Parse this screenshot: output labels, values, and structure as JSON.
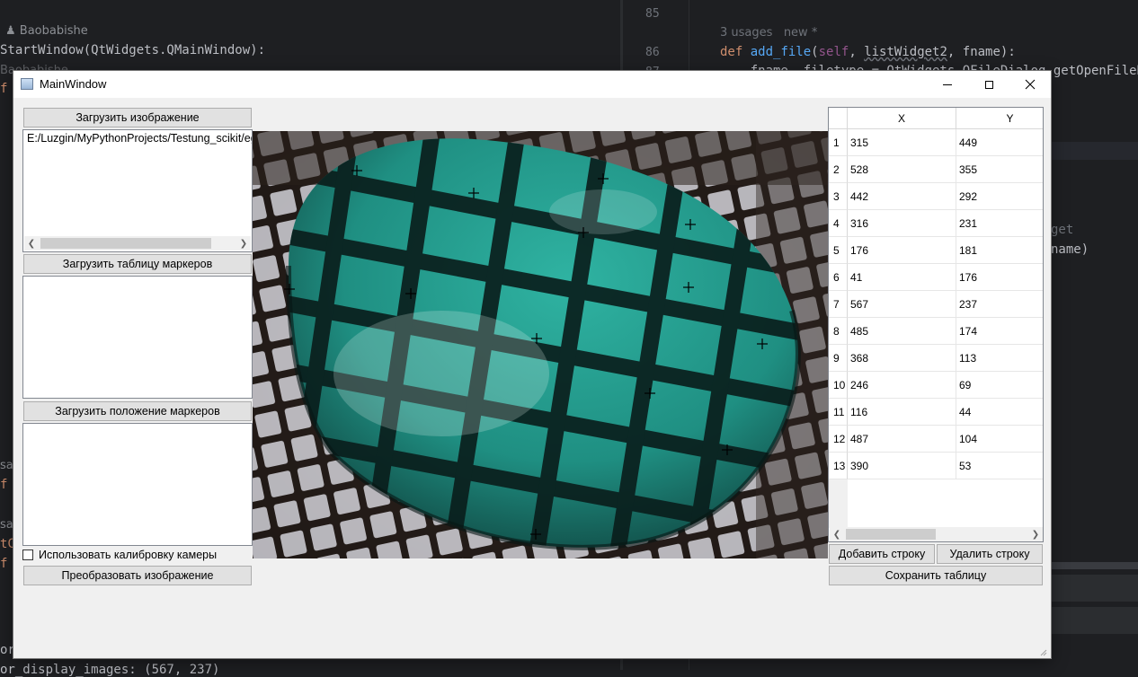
{
  "ide": {
    "author": "Baobabishe",
    "class_line": "StartWindow(QtWidgets.QMainWindow):",
    "ghost_author": "Baobabishe",
    "line_85": "85",
    "line_86": "86",
    "line_87": "87",
    "usages": "3 usages",
    "new_marker": "new *",
    "def_kw": "def",
    "fn_name": "add_file",
    "self_kw": "self",
    "param_list": "listWidget2",
    "param_rest": ", fname):",
    "open_paren": "(",
    "comma": ", ",
    "code_87": "    fname, filetype = QtWidgets.QFileDialog.getOpenFileNam",
    "frag_get": "get",
    "frag_name": "name)",
    "frag_f1": "f",
    "frag_f2": "f",
    "frag_f3": "f",
    "frag_sag1": "sag",
    "frag_sag2": "sag",
    "frag_tc": "tC",
    "frag_r": "r",
    "frag_or": "or_",
    "bottom_line": "or_display_images: (567, 237)"
  },
  "window": {
    "title": "MainWindow",
    "icons": [
      "app-icon",
      "minimize-icon",
      "maximize-icon",
      "close-icon"
    ]
  },
  "left_panel": {
    "load_image_button": "Загрузить изображение",
    "file_path": "E:/Luzgin/MyPythonProjects/Testung_scikit/egg",
    "load_marker_table_button": "Загрузить таблицу маркеров",
    "load_marker_positions_button": "Загрузить положение маркеров",
    "use_calibration_label": "Использовать калибровку камеры",
    "use_calibration_checked": false,
    "transform_button": "Преобразовать изображение"
  },
  "table": {
    "columns": [
      "X",
      "Y"
    ],
    "rows": [
      {
        "n": "1",
        "x": "315",
        "y": "449"
      },
      {
        "n": "2",
        "x": "528",
        "y": "355"
      },
      {
        "n": "3",
        "x": "442",
        "y": "292"
      },
      {
        "n": "4",
        "x": "316",
        "y": "231"
      },
      {
        "n": "5",
        "x": "176",
        "y": "181"
      },
      {
        "n": "6",
        "x": "41",
        "y": "176"
      },
      {
        "n": "7",
        "x": "567",
        "y": "237"
      },
      {
        "n": "8",
        "x": "485",
        "y": "174"
      },
      {
        "n": "9",
        "x": "368",
        "y": "113"
      },
      {
        "n": "10",
        "x": "246",
        "y": "69"
      },
      {
        "n": "11",
        "x": "116",
        "y": "44"
      },
      {
        "n": "12",
        "x": "487",
        "y": "104"
      },
      {
        "n": "13",
        "x": "390",
        "y": "53"
      }
    ],
    "add_row_button": "Добавить строку",
    "delete_row_button": "Удалить строку",
    "save_table_button": "Сохранить таблицу"
  },
  "colors": {
    "egg": "#1e8e82",
    "egg_dark": "#0f3b38",
    "ide_bg": "#1e1f22"
  }
}
